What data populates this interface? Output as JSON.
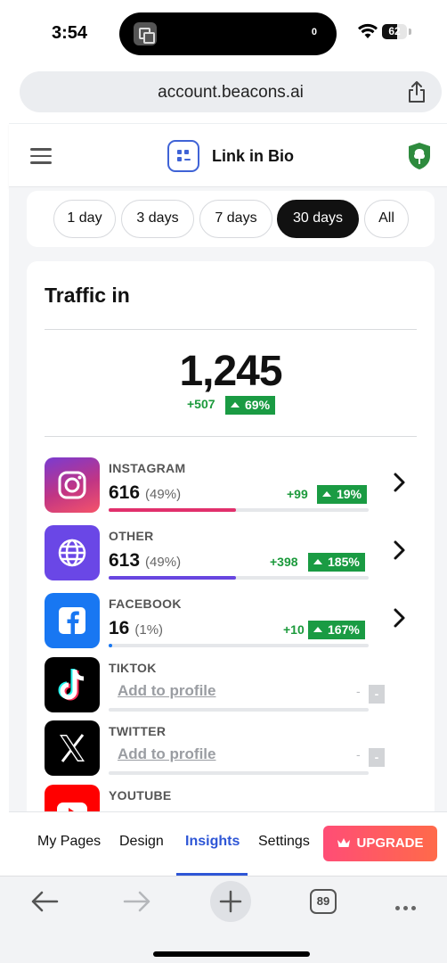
{
  "status_bar": {
    "time": "3:54",
    "island_count": "0",
    "battery": "62",
    "battery_level": 0.62
  },
  "browser": {
    "url": "account.beacons.ai",
    "tab_count": "89"
  },
  "header": {
    "brand": "Link in Bio"
  },
  "filters": {
    "options": [
      "1 day",
      "3 days",
      "7 days",
      "30 days",
      "All"
    ],
    "selected": "30 days"
  },
  "traffic": {
    "title": "Traffic in",
    "total": "1,245",
    "delta": "+507",
    "delta_pct": "69%",
    "sources": [
      {
        "name": "INSTAGRAM",
        "count": "616",
        "pct": "(49%)",
        "delta": "+99",
        "delta_pct": "19%",
        "share": 0.49,
        "color": "#e1306c"
      },
      {
        "name": "OTHER",
        "count": "613",
        "pct": "(49%)",
        "delta": "+398",
        "delta_pct": "185%",
        "share": 0.49,
        "color": "#6846e0"
      },
      {
        "name": "FACEBOOK",
        "count": "16",
        "pct": "(1%)",
        "delta": "+10",
        "delta_pct": "167%",
        "share": 0.01,
        "color": "#1877f2"
      },
      {
        "name": "TIKTOK",
        "link": "Add to profile",
        "placeholder": "-"
      },
      {
        "name": "TWITTER",
        "link": "Add to profile",
        "placeholder": "-"
      },
      {
        "name": "YOUTUBE"
      }
    ]
  },
  "bottom_tabs": {
    "items": [
      "My Pages",
      "Design",
      "Insights",
      "Settings"
    ],
    "active": "Insights",
    "upgrade": "UPGRADE"
  },
  "colors": {
    "accent": "#2e56d6",
    "positive": "#1a9b43",
    "upgrade": "#ff4d76"
  }
}
